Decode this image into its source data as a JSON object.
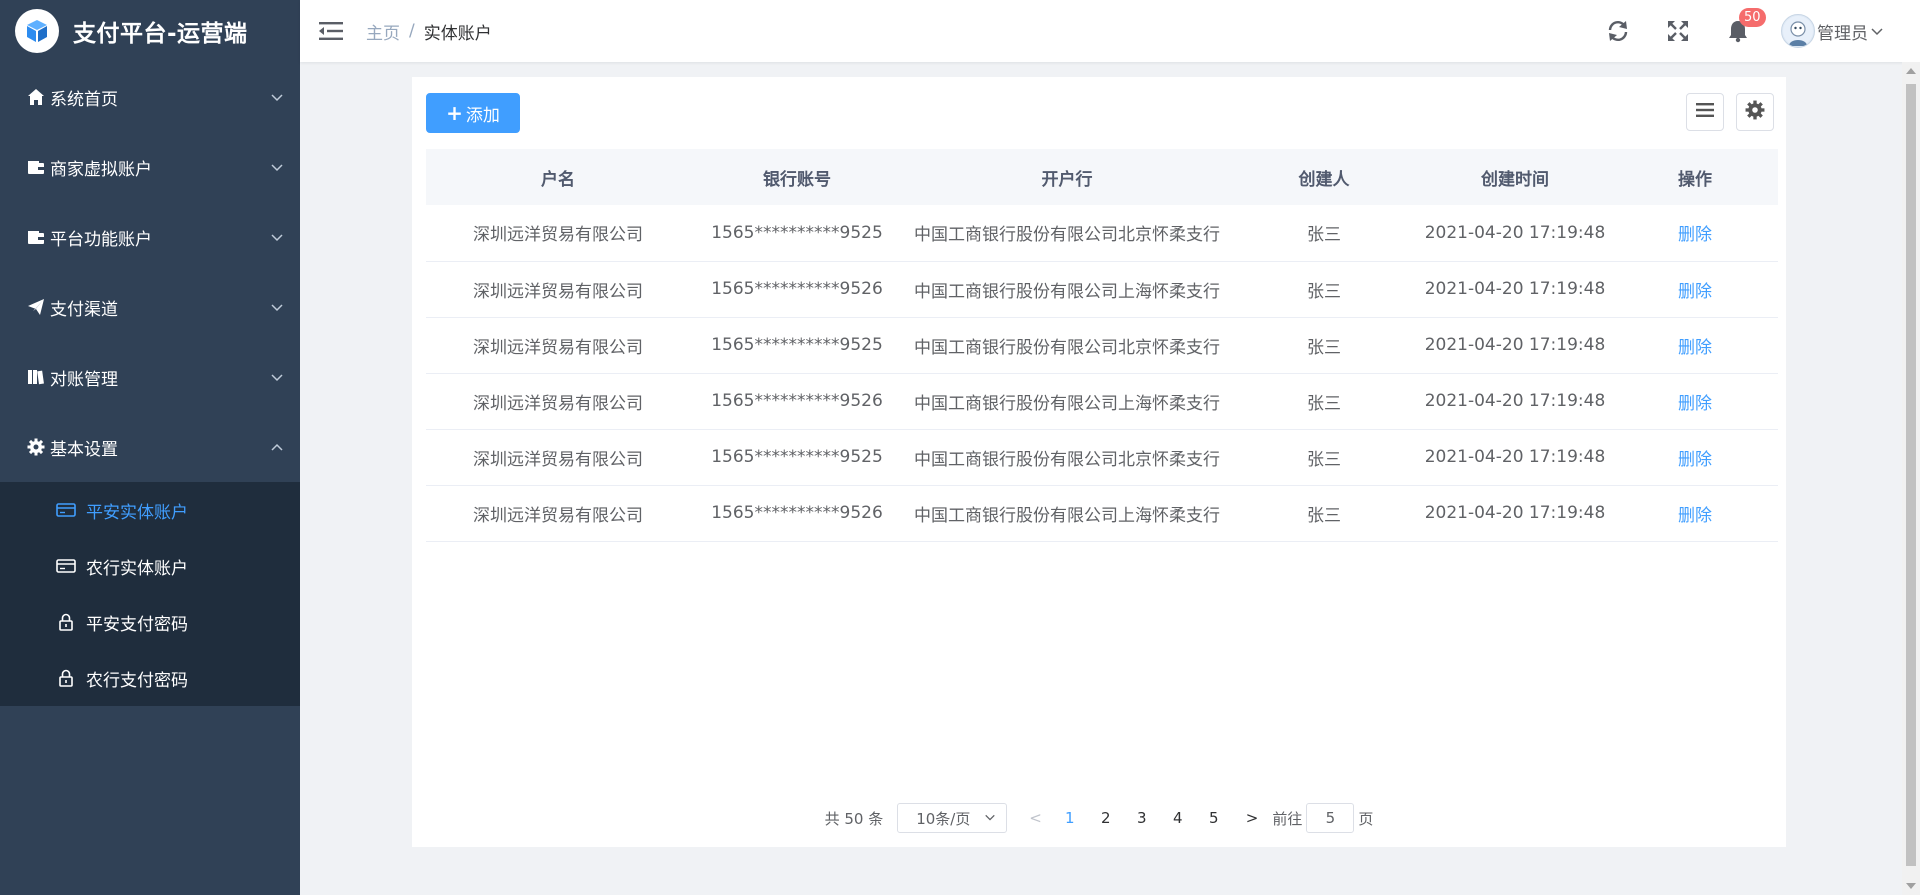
{
  "app": {
    "title": "支付平台-运营端"
  },
  "sidebar": {
    "items": [
      {
        "label": "系统首页",
        "icon": "home-icon"
      },
      {
        "label": "商家虚拟账户",
        "icon": "wallet-icon"
      },
      {
        "label": "平台功能账户",
        "icon": "wallet-icon"
      },
      {
        "label": "支付渠道",
        "icon": "paper-plane-icon"
      },
      {
        "label": "对账管理",
        "icon": "book-icon"
      },
      {
        "label": "基本设置",
        "icon": "gear-icon"
      }
    ],
    "submenu": [
      {
        "label": "平安实体账户",
        "icon": "credit-card-icon"
      },
      {
        "label": "农行实体账户",
        "icon": "credit-card-icon"
      },
      {
        "label": "平安支付密码",
        "icon": "lock-icon"
      },
      {
        "label": "农行支付密码",
        "icon": "lock-icon"
      }
    ]
  },
  "header": {
    "breadcrumb_home": "主页",
    "breadcrumb_sep": "/",
    "breadcrumb_current": "实体账户",
    "notification_count": "50",
    "user_name": "管理员"
  },
  "toolbar": {
    "add_label": "添加"
  },
  "table": {
    "columns": [
      "户名",
      "银行账号",
      "开户行",
      "创建人",
      "创建时间",
      "操作"
    ],
    "rows": [
      {
        "name": "深圳远洋贸易有限公司",
        "account": "1565**********9525",
        "bank": "中国工商银行股份有限公司北京怀柔支行",
        "creator": "张三",
        "created": "2021-04-20 17:19:48",
        "action": "删除"
      },
      {
        "name": "深圳远洋贸易有限公司",
        "account": "1565**********9526",
        "bank": "中国工商银行股份有限公司上海怀柔支行",
        "creator": "张三",
        "created": "2021-04-20 17:19:48",
        "action": "删除"
      },
      {
        "name": "深圳远洋贸易有限公司",
        "account": "1565**********9525",
        "bank": "中国工商银行股份有限公司北京怀柔支行",
        "creator": "张三",
        "created": "2021-04-20 17:19:48",
        "action": "删除"
      },
      {
        "name": "深圳远洋贸易有限公司",
        "account": "1565**********9526",
        "bank": "中国工商银行股份有限公司上海怀柔支行",
        "creator": "张三",
        "created": "2021-04-20 17:19:48",
        "action": "删除"
      },
      {
        "name": "深圳远洋贸易有限公司",
        "account": "1565**********9525",
        "bank": "中国工商银行股份有限公司北京怀柔支行",
        "creator": "张三",
        "created": "2021-04-20 17:19:48",
        "action": "删除"
      },
      {
        "name": "深圳远洋贸易有限公司",
        "account": "1565**********9526",
        "bank": "中国工商银行股份有限公司上海怀柔支行",
        "creator": "张三",
        "created": "2021-04-20 17:19:48",
        "action": "删除"
      }
    ]
  },
  "pagination": {
    "total": "共 50 条",
    "page_size": "10条/页",
    "prev": "<",
    "pages": [
      "1",
      "2",
      "3",
      "4",
      "5"
    ],
    "current_page": "1",
    "next": ">",
    "goto_label": "前往",
    "goto_value": "5",
    "goto_suffix": "页"
  },
  "colors": {
    "sidebar_bg": "#304156",
    "submenu_bg": "#1f2d3d",
    "primary": "#409eff",
    "badge": "#f56c6c"
  }
}
